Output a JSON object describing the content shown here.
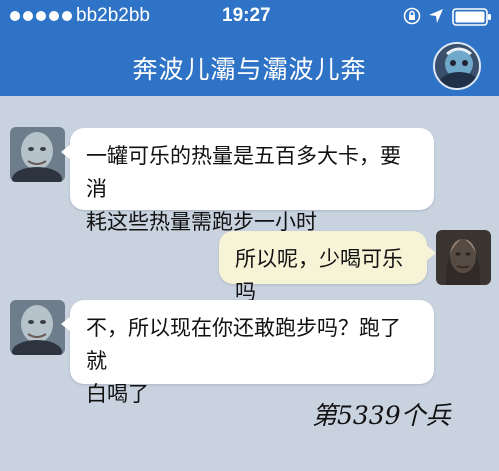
{
  "status_bar": {
    "carrier": "bb2b2bb",
    "time": "19:27",
    "icons": [
      "signal-dots",
      "orientation-lock-icon",
      "location-icon",
      "battery-icon"
    ]
  },
  "header": {
    "title": "奔波儿灞与灞波儿奔",
    "avatar_icon": "profile-avatar"
  },
  "messages": [
    {
      "side": "left",
      "avatar": "bald-man-avatar",
      "text_lines": [
        "一罐可乐的热量是五百多大卡，要消",
        "耗这些热量需跑步一小时"
      ]
    },
    {
      "side": "right",
      "avatar": "long-hair-avatar",
      "text_lines": [
        "所以呢，少喝可乐吗"
      ]
    },
    {
      "side": "left",
      "avatar": "bald-man-avatar",
      "text_lines": [
        "不，所以现在你还敢跑步吗？跑了就",
        "白喝了"
      ]
    }
  ],
  "watermark": "第5339个兵",
  "colors": {
    "header_blue": "#2f73c6",
    "chat_background": "#c9d3e0",
    "right_bubble": "#f6f3d6"
  }
}
